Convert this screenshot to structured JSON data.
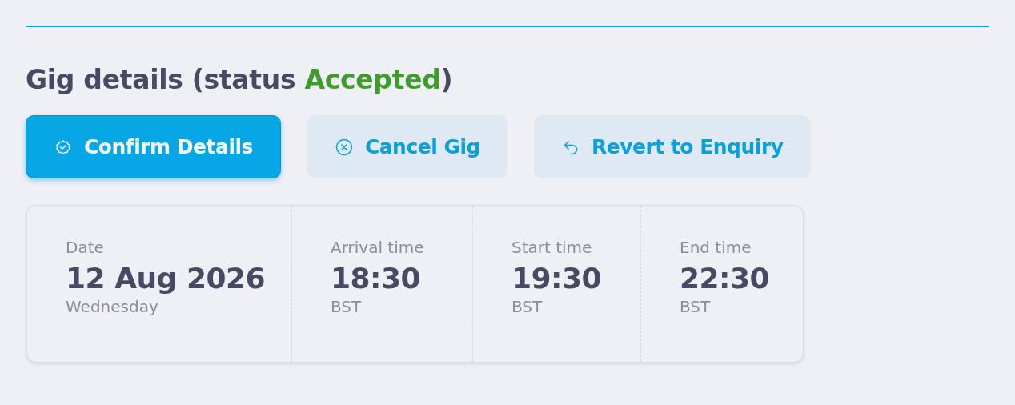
{
  "heading": {
    "prefix": "Gig details (status ",
    "status": "Accepted",
    "color": "#3f9b2b",
    "suffix": ")"
  },
  "buttons": [
    {
      "label": "Confirm Details",
      "kind": "primary"
    },
    {
      "label": "Cancel Gig",
      "kind": "secondary"
    },
    {
      "label": "Revert to Enquiry",
      "kind": "secondary"
    }
  ],
  "details": [
    {
      "label": "Date",
      "value": "12 Aug 2026",
      "sub": "Wednesday"
    },
    {
      "label": "Arrival time",
      "value": "18:30",
      "sub": "BST"
    },
    {
      "label": "Start time",
      "value": "19:30",
      "sub": "BST"
    },
    {
      "label": "End time",
      "value": "22:30",
      "sub": "BST"
    }
  ]
}
